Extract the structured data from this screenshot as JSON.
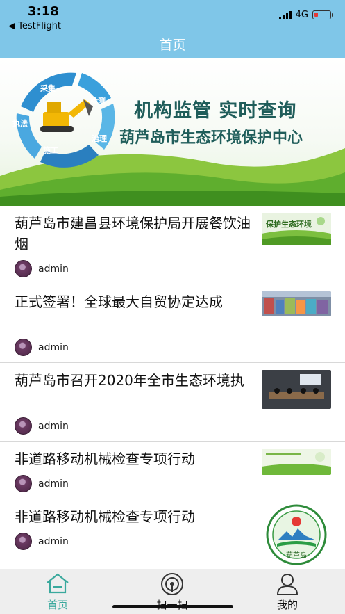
{
  "status_bar": {
    "time": "3:18",
    "back_app": "◀ TestFlight",
    "network": "4G"
  },
  "nav": {
    "title": "首页"
  },
  "banner": {
    "headline": "机构监管  实时查询",
    "organization": "葫芦岛市生态环境保护中心",
    "cycle_labels": [
      "采集",
      "检测",
      "治理",
      "施工",
      "执法"
    ]
  },
  "articles": [
    {
      "title": "葫芦岛市建昌县环境保护局开展餐饮油烟",
      "author": "admin",
      "thumb_text": "保护生态环境"
    },
    {
      "title": "正式签署！全球最大自贸协定达成",
      "author": "admin"
    },
    {
      "title": "葫芦岛市召开2020年全市生态环境执",
      "author": "admin"
    },
    {
      "title": "非道路移动机械检查专项行动",
      "author": "admin"
    },
    {
      "title": "非道路移动机械检查专项行动",
      "author": "admin",
      "thumb_text": "葫芦岛"
    }
  ],
  "tabs": [
    {
      "label": "首页",
      "active": true,
      "icon": "home-icon"
    },
    {
      "label": "扫一扫",
      "active": false,
      "icon": "scan-icon"
    },
    {
      "label": "我的",
      "active": false,
      "icon": "user-icon"
    }
  ],
  "colors": {
    "header": "#7fc6e8",
    "banner_text": "#1f5d5a",
    "active_tab": "#3aa99d",
    "battery_low": "#e53935"
  }
}
